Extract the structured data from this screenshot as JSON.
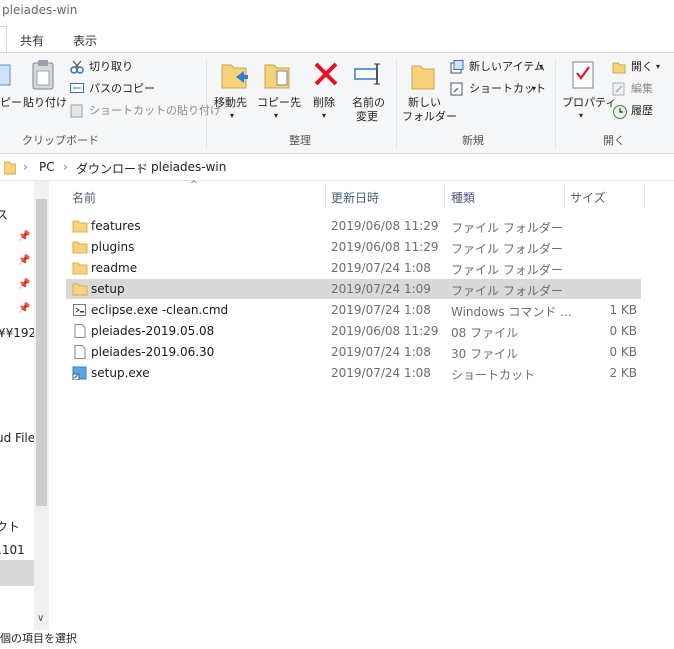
{
  "window": {
    "title": "pleiades-win"
  },
  "tabs": [
    {
      "label": "共有"
    },
    {
      "label": "表示"
    }
  ],
  "ribbon": {
    "clipboard": {
      "paste_partial": "ピー",
      "paste": "貼り付け",
      "cut": "切り取り",
      "copy_path": "パスのコピー",
      "paste_shortcut": "ショートカットの貼り付け",
      "group": "クリップボード"
    },
    "organize": {
      "move_to": "移動先",
      "copy_to": "コピー先",
      "delete": "削除",
      "rename_1": "名前の",
      "rename_2": "変更",
      "group": "整理"
    },
    "new": {
      "new_folder_1": "新しい",
      "new_folder_2": "フォルダー",
      "new_item": "新しいアイテム",
      "shortcut": "ショートカット",
      "group": "新規"
    },
    "open": {
      "properties": "プロパティ",
      "open": "開く",
      "edit": "編集",
      "history": "履歴",
      "group": "開く"
    }
  },
  "address": {
    "crumbs": [
      "PC",
      "ダウンロード",
      "pleiades-win"
    ]
  },
  "nav": {
    "items": [
      {
        "label": "ス"
      },
      {
        "label": "¥¥192"
      },
      {
        "label": "ud File"
      },
      {
        "label": "クト"
      },
      {
        "label": ".101"
      }
    ]
  },
  "columns": {
    "name": "名前",
    "date": "更新日時",
    "type": "種類",
    "size": "サイズ"
  },
  "files": [
    {
      "name": "features",
      "date": "2019/06/08 11:29",
      "type": "ファイル フォルダー",
      "size": "",
      "icon": "folder-icon"
    },
    {
      "name": "plugins",
      "date": "2019/06/08 11:29",
      "type": "ファイル フォルダー",
      "size": "",
      "icon": "folder-icon"
    },
    {
      "name": "readme",
      "date": "2019/07/24 1:08",
      "type": "ファイル フォルダー",
      "size": "",
      "icon": "folder-icon"
    },
    {
      "name": "setup",
      "date": "2019/07/24 1:09",
      "type": "ファイル フォルダー",
      "size": "",
      "icon": "folder-icon",
      "selected": true
    },
    {
      "name": "eclipse.exe -clean.cmd",
      "date": "2019/07/24 1:08",
      "type": "Windows コマンド ...",
      "size": "1 KB",
      "icon": "cmd-file-icon"
    },
    {
      "name": "pleiades-2019.05.08",
      "date": "2019/06/08 11:29",
      "type": "08 ファイル",
      "size": "0 KB",
      "icon": "file-icon"
    },
    {
      "name": "pleiades-2019.06.30",
      "date": "2019/07/24 1:08",
      "type": "30 ファイル",
      "size": "0 KB",
      "icon": "file-icon"
    },
    {
      "name": "setup.exe",
      "date": "2019/07/24 1:08",
      "type": "ショートカット",
      "size": "2 KB",
      "icon": "shortcut-icon"
    }
  ],
  "status": {
    "text": "個の項目を選択"
  }
}
